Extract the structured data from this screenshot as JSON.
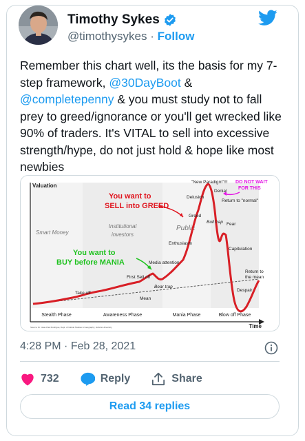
{
  "author": {
    "name": "Timothy Sykes",
    "handle": "@timothysykes",
    "separator": "·",
    "follow_label": "Follow"
  },
  "tweet": {
    "text_1": "Remember this chart well, its the basis for my 7-step framework, ",
    "mention_1": "@30DayBoot",
    "text_2": " & ",
    "mention_2": "@completepenny",
    "text_3": " & you must study not to fall prey to greed/ignorance or you'll get wrecked like 90% of traders. It's VITAL to sell into excessive strength/hype, do not just hold & hope like most  newbies"
  },
  "chart_image": {
    "y_axis_label": "Valuation",
    "x_axis_label": "Time",
    "region_labels": {
      "smart_money": "Smart Money",
      "institutional_1": "Institutional",
      "institutional_2": "investors",
      "public": "Public"
    },
    "phases": [
      "Stealth Phase",
      "Awareness Phase",
      "Mania Phase",
      "Blow off Phase"
    ],
    "annotations": {
      "new_paradigm": "\"New Paradigm\"!!!",
      "delusion": "Delusion",
      "denial": "Denial",
      "return_to_normal": "Return to \"normal\"",
      "greed": "Greed",
      "bull_trap": "Bull trap",
      "fear": "Fear",
      "enthusiasm": "Enthusiasm",
      "capitulation": "Capitulation",
      "media_attention": "Media attention",
      "first_sell_off": "First Sell off",
      "bear_trap": "Bear trap",
      "take_off": "Take off",
      "mean": "Mean",
      "return_to_mean_1": "Return to",
      "return_to_mean_2": "the mean",
      "despair": "Despair",
      "sell_1": "You want to",
      "sell_2": "SELL into GREED",
      "buy_1": "You want to",
      "buy_2": "BUY before MANIA",
      "do_not_wait_1": "DO NOT WAIT",
      "do_not_wait_2": "FOR THIS",
      "source": "Source: Dr. Jean-Paul Rodrigue, Dept. of Global Studies & Geography, Hofstra University"
    }
  },
  "meta": {
    "time": "4:28 PM",
    "date": "Feb 28, 2021"
  },
  "actions": {
    "like_count": "732",
    "reply_label": "Reply",
    "share_label": "Share"
  },
  "read_replies_label": "Read 34 replies",
  "colors": {
    "accent": "#1d9bf0",
    "like": "#f91880",
    "chart_line": "#d81f26",
    "sell_text": "#e0141e",
    "buy_text": "#1fc21f",
    "wait_text": "#e414e4"
  }
}
